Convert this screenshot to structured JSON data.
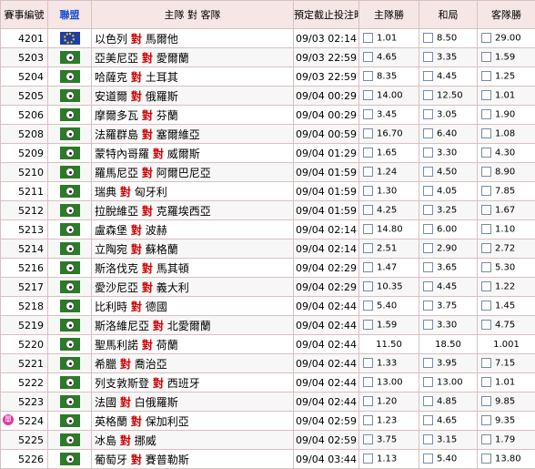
{
  "headers": {
    "id": "賽事編號",
    "league": "聯盟",
    "match": "主隊 對 客隊",
    "time": "預定截止投注時間",
    "home": "主隊勝",
    "draw": "和局",
    "away": "客隊勝"
  },
  "vs_label": "對",
  "rows": [
    {
      "id": "4201",
      "league_icon": "europe-flag-icon",
      "home_team": "以色列",
      "away_team": "馬爾他",
      "time": "09/03 02:14",
      "home": "1.01",
      "draw": "8.50",
      "away": "29.00",
      "selectable": true,
      "mark": ""
    },
    {
      "id": "5203",
      "league_icon": "soccer-ball-icon",
      "home_team": "亞美尼亞",
      "away_team": "愛爾蘭",
      "time": "09/03 22:59",
      "home": "4.65",
      "draw": "3.35",
      "away": "1.59",
      "selectable": true,
      "mark": ""
    },
    {
      "id": "5204",
      "league_icon": "soccer-ball-icon",
      "home_team": "哈薩克",
      "away_team": "土耳其",
      "time": "09/03 22:59",
      "home": "8.35",
      "draw": "4.45",
      "away": "1.25",
      "selectable": true,
      "mark": ""
    },
    {
      "id": "5205",
      "league_icon": "soccer-ball-icon",
      "home_team": "安道爾",
      "away_team": "俄羅斯",
      "time": "09/04 00:29",
      "home": "14.00",
      "draw": "12.50",
      "away": "1.01",
      "selectable": true,
      "mark": ""
    },
    {
      "id": "5206",
      "league_icon": "soccer-ball-icon",
      "home_team": "摩爾多瓦",
      "away_team": "芬蘭",
      "time": "09/04 00:29",
      "home": "3.45",
      "draw": "3.05",
      "away": "1.90",
      "selectable": true,
      "mark": ""
    },
    {
      "id": "5208",
      "league_icon": "soccer-ball-icon",
      "home_team": "法羅群島",
      "away_team": "塞爾維亞",
      "time": "09/04 00:59",
      "home": "16.70",
      "draw": "6.40",
      "away": "1.08",
      "selectable": true,
      "mark": ""
    },
    {
      "id": "5209",
      "league_icon": "soccer-ball-icon",
      "home_team": "蒙特內哥羅",
      "away_team": "威爾斯",
      "time": "09/04 01:29",
      "home": "1.65",
      "draw": "3.30",
      "away": "4.30",
      "selectable": true,
      "mark": ""
    },
    {
      "id": "5210",
      "league_icon": "soccer-ball-icon",
      "home_team": "羅馬尼亞",
      "away_team": "阿爾巴尼亞",
      "time": "09/04 01:59",
      "home": "1.24",
      "draw": "4.50",
      "away": "8.90",
      "selectable": true,
      "mark": ""
    },
    {
      "id": "5211",
      "league_icon": "soccer-ball-icon",
      "home_team": "瑞典",
      "away_team": "匈牙利",
      "time": "09/04 01:59",
      "home": "1.30",
      "draw": "4.05",
      "away": "7.85",
      "selectable": true,
      "mark": ""
    },
    {
      "id": "5212",
      "league_icon": "soccer-ball-icon",
      "home_team": "拉脫維亞",
      "away_team": "克羅埃西亞",
      "time": "09/04 01:59",
      "home": "4.25",
      "draw": "3.25",
      "away": "1.67",
      "selectable": true,
      "mark": ""
    },
    {
      "id": "5213",
      "league_icon": "soccer-ball-icon",
      "home_team": "盧森堡",
      "away_team": "波赫",
      "time": "09/04 02:14",
      "home": "14.80",
      "draw": "6.00",
      "away": "1.10",
      "selectable": true,
      "mark": ""
    },
    {
      "id": "5214",
      "league_icon": "soccer-ball-icon",
      "home_team": "立陶宛",
      "away_team": "蘇格蘭",
      "time": "09/04 02:14",
      "home": "2.51",
      "draw": "2.90",
      "away": "2.72",
      "selectable": true,
      "mark": ""
    },
    {
      "id": "5216",
      "league_icon": "soccer-ball-icon",
      "home_team": "斯洛伐克",
      "away_team": "馬其頓",
      "time": "09/04 02:29",
      "home": "1.47",
      "draw": "3.65",
      "away": "5.30",
      "selectable": true,
      "mark": ""
    },
    {
      "id": "5217",
      "league_icon": "soccer-ball-icon",
      "home_team": "愛沙尼亞",
      "away_team": "義大利",
      "time": "09/04 02:29",
      "home": "10.35",
      "draw": "4.45",
      "away": "1.22",
      "selectable": true,
      "mark": ""
    },
    {
      "id": "5218",
      "league_icon": "soccer-ball-icon",
      "home_team": "比利時",
      "away_team": "德國",
      "time": "09/04 02:44",
      "home": "5.40",
      "draw": "3.75",
      "away": "1.45",
      "selectable": true,
      "mark": ""
    },
    {
      "id": "5219",
      "league_icon": "soccer-ball-icon",
      "home_team": "斯洛維尼亞",
      "away_team": "北愛爾蘭",
      "time": "09/04 02:44",
      "home": "1.59",
      "draw": "3.30",
      "away": "4.75",
      "selectable": true,
      "mark": ""
    },
    {
      "id": "5220",
      "league_icon": "soccer-ball-icon",
      "home_team": "聖馬利諾",
      "away_team": "荷蘭",
      "time": "09/04 02:44",
      "home": "11.50",
      "draw": "18.50",
      "away": "1.001",
      "selectable": false,
      "mark": ""
    },
    {
      "id": "5221",
      "league_icon": "soccer-ball-icon",
      "home_team": "希臘",
      "away_team": "喬治亞",
      "time": "09/04 02:44",
      "home": "1.33",
      "draw": "3.95",
      "away": "7.15",
      "selectable": true,
      "mark": ""
    },
    {
      "id": "5222",
      "league_icon": "soccer-ball-icon",
      "home_team": "列支敦斯登",
      "away_team": "西班牙",
      "time": "09/04 02:44",
      "home": "13.00",
      "draw": "13.00",
      "away": "1.01",
      "selectable": true,
      "mark": ""
    },
    {
      "id": "5223",
      "league_icon": "soccer-ball-icon",
      "home_team": "法國",
      "away_team": "白俄羅斯",
      "time": "09/04 02:44",
      "home": "1.20",
      "draw": "4.85",
      "away": "9.85",
      "selectable": true,
      "mark": ""
    },
    {
      "id": "5224",
      "league_icon": "soccer-ball-icon",
      "home_team": "英格蘭",
      "away_team": "保加利亞",
      "time": "09/04 02:59",
      "home": "1.23",
      "draw": "4.65",
      "away": "9.35",
      "selectable": true,
      "mark": "單"
    },
    {
      "id": "5225",
      "league_icon": "soccer-ball-icon",
      "home_team": "冰島",
      "away_team": "挪威",
      "time": "09/04 02:59",
      "home": "3.75",
      "draw": "3.15",
      "away": "1.79",
      "selectable": true,
      "mark": ""
    },
    {
      "id": "5226",
      "league_icon": "soccer-ball-icon",
      "home_team": "葡萄牙",
      "away_team": "賽普勒斯",
      "time": "09/04 03:44",
      "home": "1.13",
      "draw": "5.40",
      "away": "13.80",
      "selectable": true,
      "mark": ""
    }
  ]
}
